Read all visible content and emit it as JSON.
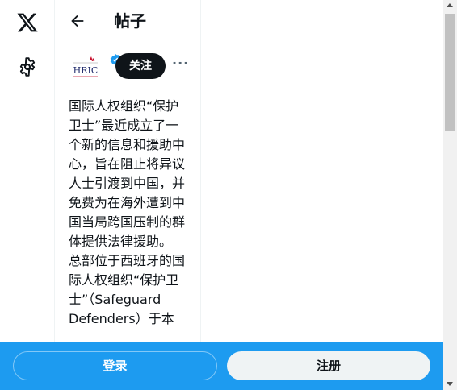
{
  "nav": {
    "logo_icon": "x-logo-icon",
    "settings_icon": "gear-icon"
  },
  "header": {
    "back_icon": "back-arrow-icon",
    "title": "帖子"
  },
  "author": {
    "avatar_text": "HRIC",
    "verified_icon": "verified-badge-icon",
    "follow_label": "关注",
    "more_label": "···"
  },
  "tweet": {
    "paragraphs": [
      "国际人权组织“保护卫士”最近成立了一个新的信息和援助中心，旨在阻止将异议人士引渡到中国，并免费为在海外遭到中国当局跨国压制的群体提供法律援助。",
      "总部位于西班牙的国际人权组织“保护卫士”（Safeguard Defenders）于本"
    ]
  },
  "bottom_bar": {
    "login_label": "登录",
    "signup_label": "注册"
  },
  "colors": {
    "accent": "#1d9bf0",
    "text": "#0f1419",
    "button_dark": "#0f1419",
    "button_light": "#eff3f4"
  }
}
